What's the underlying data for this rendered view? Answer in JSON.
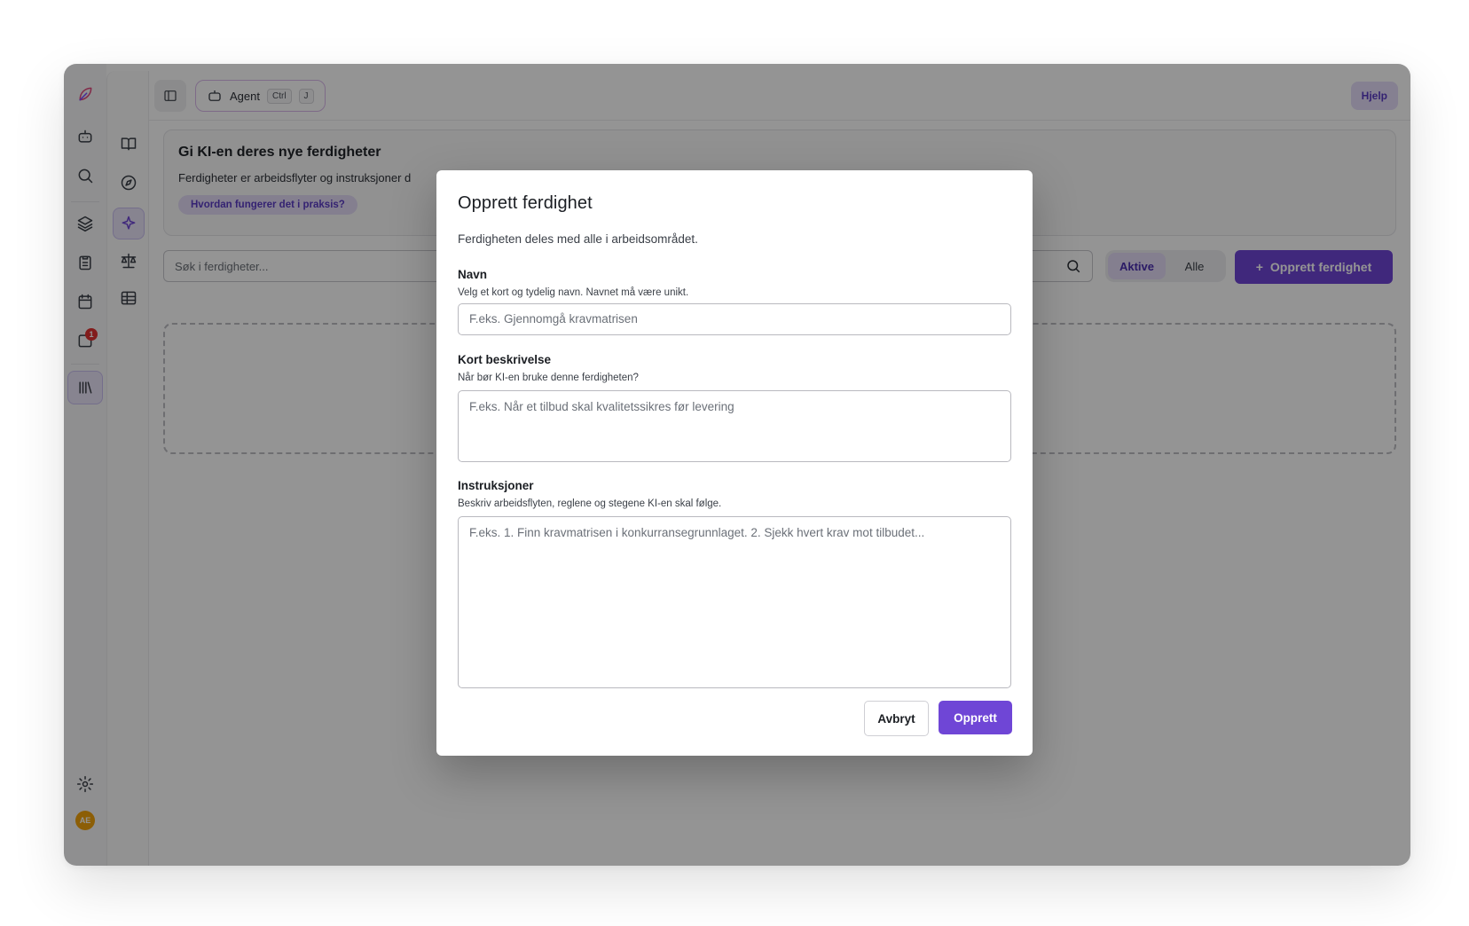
{
  "topbar": {
    "agent_label": "Agent",
    "shortcut_ctrl": "Ctrl",
    "shortcut_key": "J",
    "help_label": "Hjelp"
  },
  "rail": {
    "notification_count": "1",
    "avatar_initials": "AE"
  },
  "hero": {
    "title": "Gi KI-en deres nye ferdigheter",
    "description": "Ferdigheter er arbeidsflyter og instruksjoner d",
    "link_label": "Hvordan fungerer det i praksis?"
  },
  "toolbar": {
    "search_placeholder": "Søk i ferdigheter...",
    "filter_active": "Aktive",
    "filter_all": "Alle",
    "create_label": "Opprett ferdighet"
  },
  "modal": {
    "title": "Opprett ferdighet",
    "subtitle": "Ferdigheten deles med alle i arbeidsområdet.",
    "name_label": "Navn",
    "name_hint": "Velg et kort og tydelig navn. Navnet må være unikt.",
    "name_placeholder": "F.eks. Gjennomgå kravmatrisen",
    "desc_label": "Kort beskrivelse",
    "desc_hint": "Når bør KI-en bruke denne ferdigheten?",
    "desc_placeholder": "F.eks. Når et tilbud skal kvalitetssikres før levering",
    "instr_label": "Instruksjoner",
    "instr_hint": "Beskriv arbeidsflyten, reglene og stegene KI-en skal følge.",
    "instr_placeholder": "F.eks. 1. Finn kravmatrisen i konkurransegrunnlaget. 2. Sjekk hvert krav mot tilbudet...",
    "cancel_label": "Avbryt",
    "submit_label": "Opprett"
  },
  "colors": {
    "accent": "#6f46d6",
    "overlay": "rgba(0,0,0,0.42)",
    "badge": "#e03131",
    "avatar": "#f2a20b"
  }
}
